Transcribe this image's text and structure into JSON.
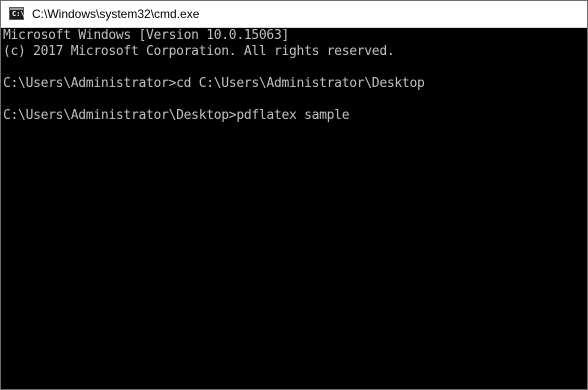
{
  "window": {
    "title": "C:\\Windows\\system32\\cmd.exe",
    "icon": "command-prompt-icon",
    "prompt_glyph": "C:\\"
  },
  "console": {
    "lines": [
      "Microsoft Windows [Version 10.0.15063]",
      "(c) 2017 Microsoft Corporation. All rights reserved.",
      "",
      "C:\\Users\\Administrator>cd C:\\Users\\Administrator\\Desktop",
      "",
      "C:\\Users\\Administrator\\Desktop>pdflatex sample"
    ],
    "text_color": "#c0c0c0",
    "background_color": "#000000"
  }
}
